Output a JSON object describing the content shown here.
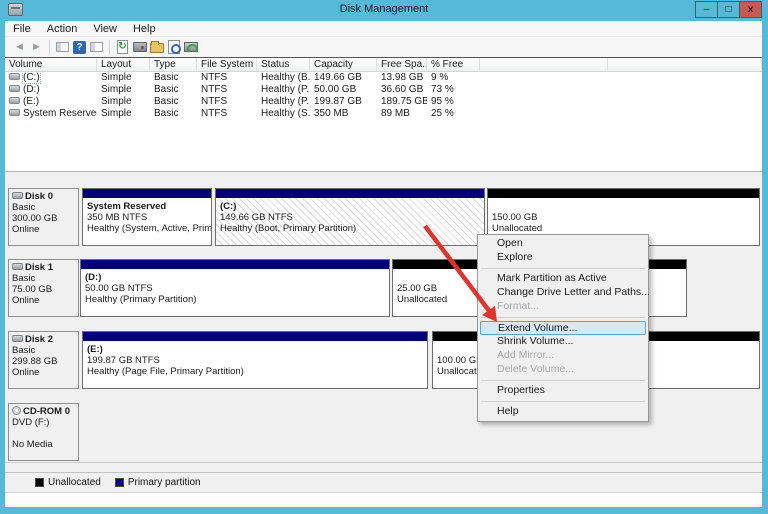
{
  "win": {
    "title": "Disk Management"
  },
  "controls": {
    "minimize": "–",
    "maximize": "□",
    "close": "x"
  },
  "menu": {
    "items": [
      "File",
      "Action",
      "View",
      "Help"
    ]
  },
  "toolbar": {
    "glyphs": {
      "back": "◄",
      "forward": "►",
      "help": "?",
      "refresh": "↻"
    }
  },
  "table": {
    "columns": [
      "Volume",
      "Layout",
      "Type",
      "File System",
      "Status",
      "Capacity",
      "Free Spa...",
      "% Free"
    ],
    "rows": [
      {
        "name": "(C:)",
        "layout": "Simple",
        "type": "Basic",
        "fs": "NTFS",
        "status": "Healthy (B...",
        "capacity": "149.66 GB",
        "free": "13.98 GB",
        "pct": "9 %"
      },
      {
        "name": "(D:)",
        "layout": "Simple",
        "type": "Basic",
        "fs": "NTFS",
        "status": "Healthy (P...",
        "capacity": "50.00 GB",
        "free": "36.60 GB",
        "pct": "73 %"
      },
      {
        "name": "(E:)",
        "layout": "Simple",
        "type": "Basic",
        "fs": "NTFS",
        "status": "Healthy (P...",
        "capacity": "199.87 GB",
        "free": "189.75 GB",
        "pct": "95 %"
      },
      {
        "name": "System Reserved",
        "layout": "Simple",
        "type": "Basic",
        "fs": "NTFS",
        "status": "Healthy (S...",
        "capacity": "350 MB",
        "free": "89 MB",
        "pct": "25 %"
      }
    ]
  },
  "disks": [
    {
      "name": "Disk 0",
      "lines": [
        "Basic",
        "300.00 GB",
        "Online"
      ],
      "partitions": [
        {
          "title": "System Reserved",
          "l2": "350 MB NTFS",
          "l3": "Healthy (System, Active, Primary"
        },
        {
          "title": "(C:)",
          "l2": "149.66 GB NTFS",
          "l3": "Healthy (Boot, Primary Partition)"
        },
        {
          "title": "150.00 GB",
          "l2": "Unallocated"
        }
      ]
    },
    {
      "name": "Disk 1",
      "lines": [
        "Basic",
        "75.00 GB",
        "Online"
      ],
      "partitions": [
        {
          "title": "(D:)",
          "l2": "50.00 GB NTFS",
          "l3": "Healthy (Primary Partition)"
        },
        {
          "title": "25.00 GB",
          "l2": "Unallocated"
        }
      ]
    },
    {
      "name": "Disk 2",
      "lines": [
        "Basic",
        "299.88 GB",
        "Online"
      ],
      "partitions": [
        {
          "title": "(E:)",
          "l2": "199.87 GB NTFS",
          "l3": "Healthy (Page File, Primary Partition)"
        },
        {
          "title": "100.00 GB",
          "l2": "Unallocated"
        }
      ]
    },
    {
      "name": "CD-ROM 0",
      "lines": [
        "DVD (F:)",
        "No Media"
      ],
      "partitions": []
    }
  ],
  "cm": {
    "items": [
      {
        "label": "Open"
      },
      {
        "label": "Explore"
      },
      {
        "label": "Mark Partition as Active"
      },
      {
        "label": "Change Drive Letter and Paths..."
      },
      {
        "label": "Format...",
        "disabled": true
      },
      {
        "label": "Extend Volume...",
        "highlight": true
      },
      {
        "label": "Shrink Volume..."
      },
      {
        "label": "Add Mirror...",
        "disabled": true
      },
      {
        "label": "Delete Volume...",
        "disabled": true
      },
      {
        "label": "Properties"
      },
      {
        "label": "Help"
      }
    ]
  },
  "legend": {
    "items": [
      {
        "label": "Unallocated",
        "color": "#000000"
      },
      {
        "label": "Primary partition",
        "color": "#00007e"
      }
    ]
  },
  "colors": {
    "titlebar": "#57b9d8",
    "close_button": "#c75a52",
    "primary_partition": "#00007e",
    "unallocated": "#000000",
    "menu_highlight": "#d3e9f8",
    "annotation_arrow": "#e0342c"
  }
}
